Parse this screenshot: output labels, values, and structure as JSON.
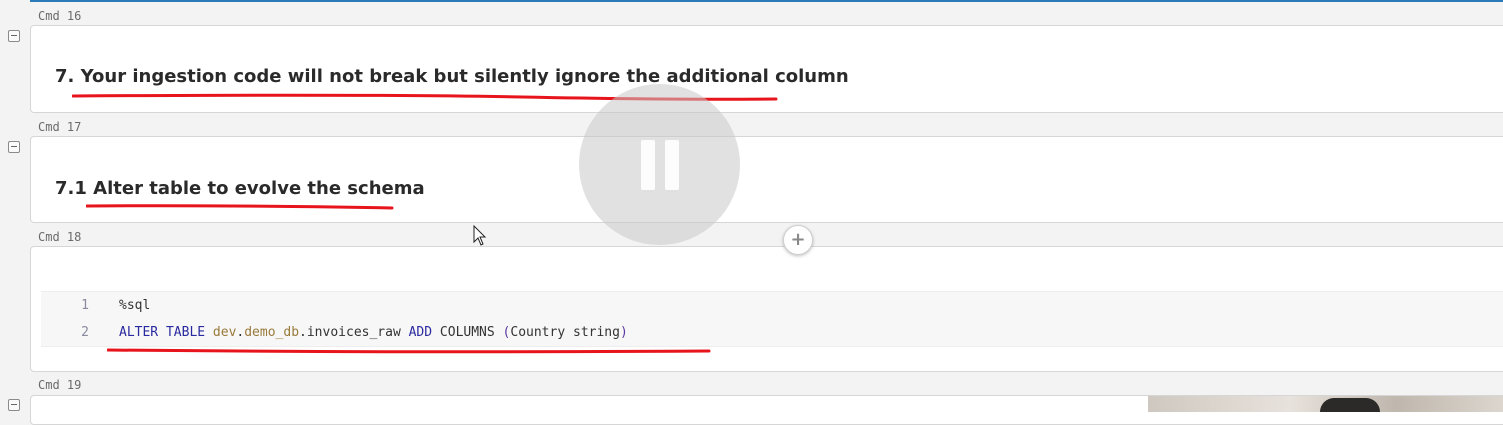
{
  "cells": [
    {
      "cmd": "Cmd 16",
      "type": "markdown",
      "heading": "7. Your ingestion code will not break but silently ignore the additional column"
    },
    {
      "cmd": "Cmd 17",
      "type": "markdown",
      "heading": "7.1 Alter table to evolve the schema"
    },
    {
      "cmd": "Cmd 18",
      "type": "code",
      "lines": [
        {
          "num": "1",
          "text": "%sql"
        },
        {
          "num": "2",
          "tokens": {
            "kw1": "ALTER TABLE ",
            "id1": "dev",
            "dot1": ".",
            "id2": "demo_db",
            "rest1": ".invoices_raw ",
            "kw2": "ADD",
            "rest2": " COLUMNS ",
            "paren_open": "(",
            "arg": "Country string",
            "paren_close": ")"
          }
        }
      ]
    },
    {
      "cmd": "Cmd 19",
      "type": "collapsed"
    }
  ],
  "add_cell_symbol": "+",
  "annotation_color": "#e8141c",
  "accent_color": "#2a7ab8",
  "icons": [
    "collapse-icon",
    "plus-icon",
    "pause-icon",
    "mouse-cursor-icon"
  ]
}
